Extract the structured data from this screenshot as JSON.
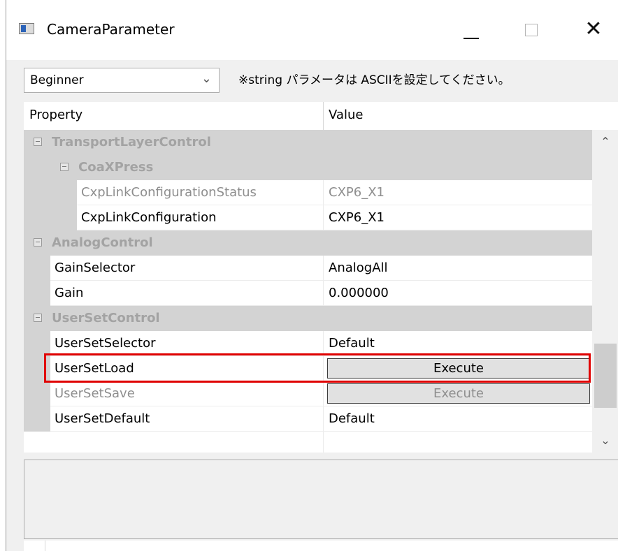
{
  "window": {
    "title": "CameraParameter",
    "close_glyph": "✕"
  },
  "toolbar": {
    "visibility": "Beginner",
    "note": "※string パラメータは ASCIIを設定してください。"
  },
  "grid": {
    "headers": {
      "property": "Property",
      "value": "Value"
    },
    "categories": {
      "transport": "TransportLayerControl",
      "coaxpress": "CoaXPress",
      "analog": "AnalogControl",
      "userset": "UserSetControl"
    },
    "rows": {
      "cxp_status": {
        "name": "CxpLinkConfigurationStatus",
        "value": "CXP6_X1",
        "enabled": false
      },
      "cxp_config": {
        "name": "CxpLinkConfiguration",
        "value": "CXP6_X1",
        "enabled": true
      },
      "gain_selector": {
        "name": "GainSelector",
        "value": "AnalogAll",
        "enabled": true
      },
      "gain": {
        "name": "Gain",
        "value": "0.000000",
        "enabled": true
      },
      "userset_selector": {
        "name": "UserSetSelector",
        "value": "Default",
        "enabled": true
      },
      "userset_load": {
        "name": "UserSetLoad",
        "button": "Execute",
        "enabled": true,
        "highlighted": true
      },
      "userset_save": {
        "name": "UserSetSave",
        "button": "Execute",
        "enabled": false
      },
      "userset_default": {
        "name": "UserSetDefault",
        "value": "Default",
        "enabled": true
      }
    }
  },
  "colors": {
    "highlight": "#e00000",
    "category_bg": "#d3d3d3",
    "category_text": "#a3a3a3",
    "disabled_text": "#8e8e8e"
  },
  "icons": {
    "app": "camera-parameter-app-icon",
    "collapse": "minus-box-icon",
    "dropdown": "chevron-down-icon",
    "scroll_up": "chevron-up-icon",
    "scroll_down": "chevron-down-icon"
  }
}
